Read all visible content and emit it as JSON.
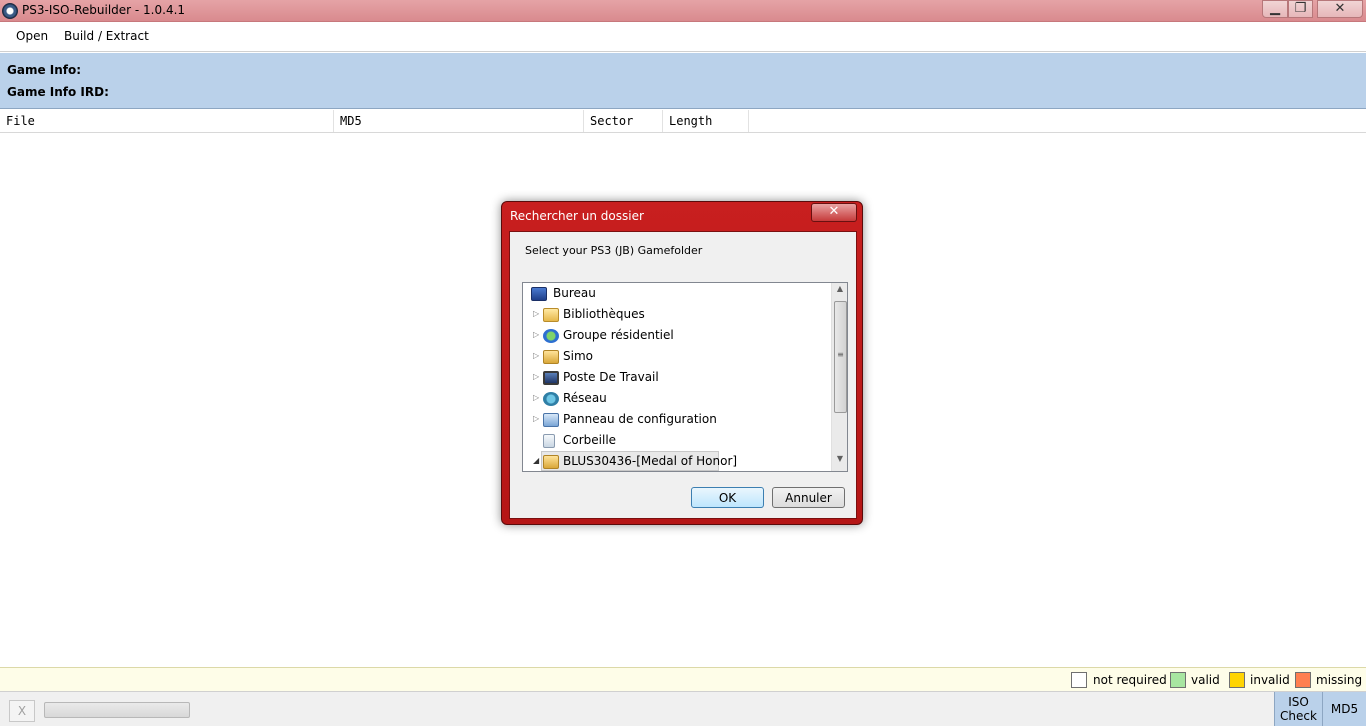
{
  "window": {
    "title": "PS3-ISO-Rebuilder - 1.0.4.1",
    "minimize": "▁",
    "maximize": "❐",
    "close": "✕"
  },
  "menu": {
    "open": "Open",
    "build_extract": "Build / Extract"
  },
  "info": {
    "game_info": "Game Info:",
    "game_info_ird": "Game Info IRD:"
  },
  "table": {
    "columns": [
      "File",
      "MD5",
      "Sector",
      "Length"
    ]
  },
  "legend": [
    {
      "label": "not required",
      "color": "#ffffff"
    },
    {
      "label": "valid",
      "color": "#a8e6a1"
    },
    {
      "label": "invalid",
      "color": "#ffd400"
    },
    {
      "label": "missing",
      "color": "#ff7f50"
    }
  ],
  "bottom": {
    "cancel": "X",
    "iso_check_1": "ISO",
    "iso_check_2": "Check",
    "md5": "MD5"
  },
  "dialog": {
    "title": "Rechercher un dossier",
    "close": "✕",
    "prompt": "Select your PS3 (JB) Gamefolder",
    "tree": [
      {
        "label": "Bureau",
        "icon": "desktop-icon"
      },
      {
        "label": "Bibliothèques",
        "icon": "libraries-icon"
      },
      {
        "label": "Groupe résidentiel",
        "icon": "homegroup-icon"
      },
      {
        "label": "Simo",
        "icon": "user-folder-icon"
      },
      {
        "label": "Poste De Travail",
        "icon": "computer-icon"
      },
      {
        "label": "Réseau",
        "icon": "network-icon"
      },
      {
        "label": "Panneau de configuration",
        "icon": "control-panel-icon"
      },
      {
        "label": "Corbeille",
        "icon": "recycle-bin-icon"
      },
      {
        "label": "BLUS30436-[Medal of Honor]",
        "icon": "folder-icon"
      }
    ],
    "ok": "OK",
    "cancel": "Annuler"
  }
}
